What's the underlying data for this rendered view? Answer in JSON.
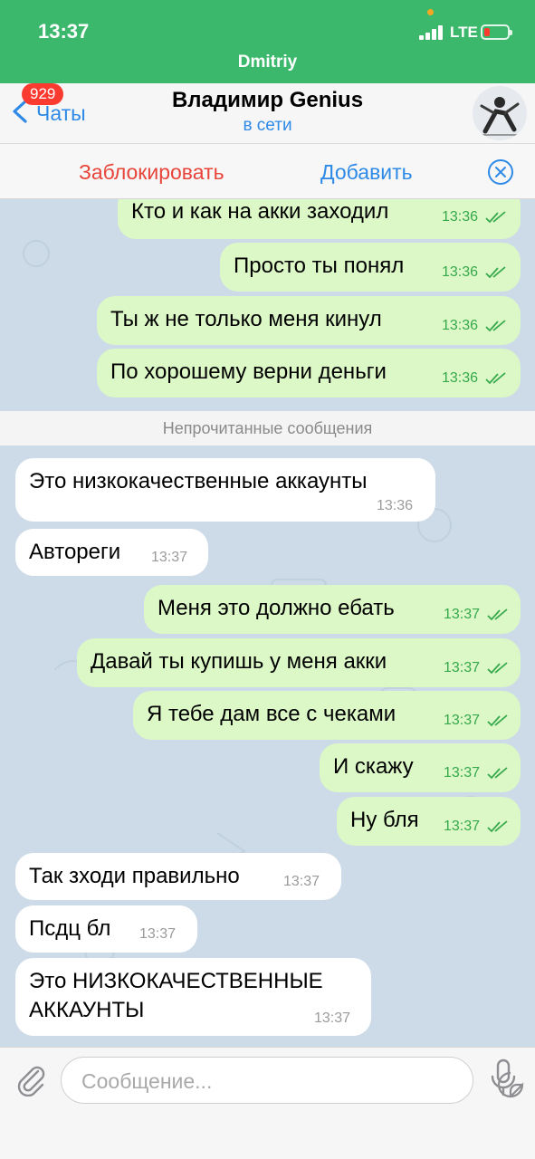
{
  "status": {
    "time": "13:37",
    "network": "LTE",
    "call_name": "Dmitriy"
  },
  "header": {
    "back_label": "Чаты",
    "unread_badge": "929",
    "title": "Владимир Genius",
    "subtitle": "в сети"
  },
  "actions": {
    "block": "Заблокировать",
    "add": "Добавить"
  },
  "chat": {
    "unread_divider": "Непрочитанные сообщения",
    "messages": [
      {
        "dir": "out",
        "text": "Кто и как на акки заходил",
        "time": "13:36"
      },
      {
        "dir": "out",
        "text": "Просто ты понял",
        "time": "13:36"
      },
      {
        "dir": "out",
        "text": "Ты ж не только меня кинул",
        "time": "13:36"
      },
      {
        "dir": "out",
        "text": "По хорошему верни деньги",
        "time": "13:36"
      },
      {
        "dir": "in",
        "text": "Это низкокачественные аккаунты",
        "time": "13:36"
      },
      {
        "dir": "in",
        "text": "Автореги",
        "time": "13:37"
      },
      {
        "dir": "out",
        "text": "Меня это должно ебать",
        "time": "13:37"
      },
      {
        "dir": "out",
        "text": "Давай ты купишь у меня акки",
        "time": "13:37"
      },
      {
        "dir": "out",
        "text": "Я тебе дам все с чеками",
        "time": "13:37"
      },
      {
        "dir": "out",
        "text": "И скажу",
        "time": "13:37"
      },
      {
        "dir": "out",
        "text": "Ну бля",
        "time": "13:37"
      },
      {
        "dir": "in",
        "text": "Так зходи правильно",
        "time": "13:37"
      },
      {
        "dir": "in",
        "text": "Псдц бл",
        "time": "13:37"
      },
      {
        "dir": "in",
        "text_line1": "Это НИЗКОКАЧЕСТВЕННЫЕ",
        "text_line2": "АККАУНТЫ",
        "time": "13:37"
      }
    ]
  },
  "input": {
    "placeholder": "Сообщение..."
  },
  "colors": {
    "accent": "#2e8ae6",
    "call_bar": "#3cb86c",
    "outgoing": "#dcf8c6",
    "block": "#e8453a"
  }
}
